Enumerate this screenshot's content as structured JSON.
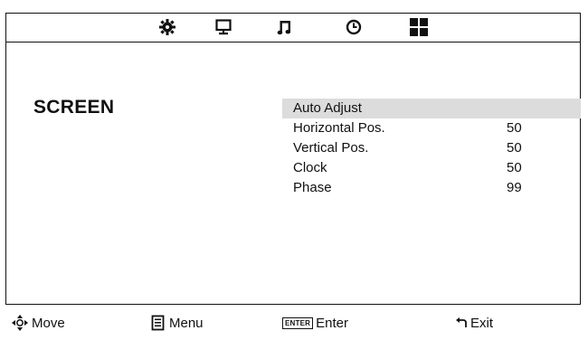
{
  "tabs": [
    {
      "icon": "picture-gear-icon"
    },
    {
      "icon": "monitor-screen-icon"
    },
    {
      "icon": "music-note-icon"
    },
    {
      "icon": "clock-icon"
    },
    {
      "icon": "grid-setup-icon"
    }
  ],
  "page": {
    "title": "SCREEN"
  },
  "menu": {
    "items": [
      {
        "label": "Auto Adjust",
        "value": "",
        "selected": true
      },
      {
        "label": "Horizontal Pos.",
        "value": "50",
        "selected": false
      },
      {
        "label": "Vertical Pos.",
        "value": "50",
        "selected": false
      },
      {
        "label": "Clock",
        "value": "50",
        "selected": false
      },
      {
        "label": "Phase",
        "value": "99",
        "selected": false
      }
    ]
  },
  "footer": {
    "move_label": "Move",
    "menu_label": "Menu",
    "enter_key": "ENTER",
    "enter_label": "Enter",
    "exit_label": "Exit"
  },
  "colors": {
    "selected_row": "#dcdcdc",
    "foreground": "#111111",
    "background": "#ffffff"
  }
}
